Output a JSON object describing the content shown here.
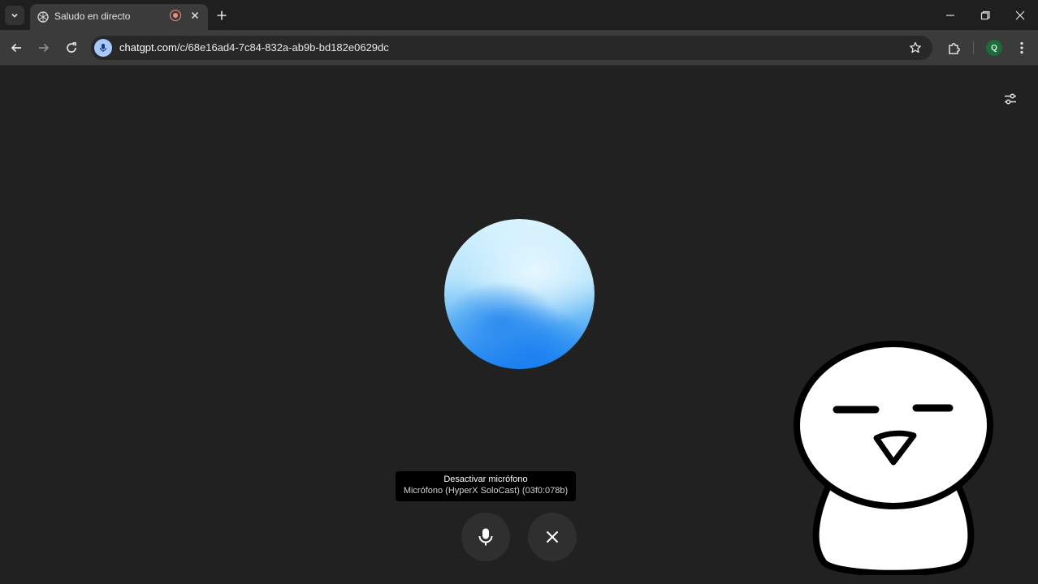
{
  "browser": {
    "tab": {
      "title": "Saludo en directo",
      "favicon": "openai-icon",
      "recording_indicator": "recording-icon"
    },
    "address_bar": {
      "url_host": "chatgpt.com",
      "url_path": "/c/68e16ad4-7c84-832a-ab9b-bd182e0629dc"
    },
    "profile": {
      "initial": "Q",
      "color": "#1e6b3a"
    }
  },
  "voice_mode": {
    "tooltip": {
      "title": "Desactivar micrófono",
      "subtitle": "Micrófono (HyperX SoloCast) (03f0:078b)"
    },
    "orb_colors": [
      "#d8f3ff",
      "#5fb3f5",
      "#1e84f2"
    ],
    "buttons": [
      "microphone-icon",
      "close-icon"
    ]
  },
  "overlay": {
    "mascot": "cartoon-character"
  }
}
